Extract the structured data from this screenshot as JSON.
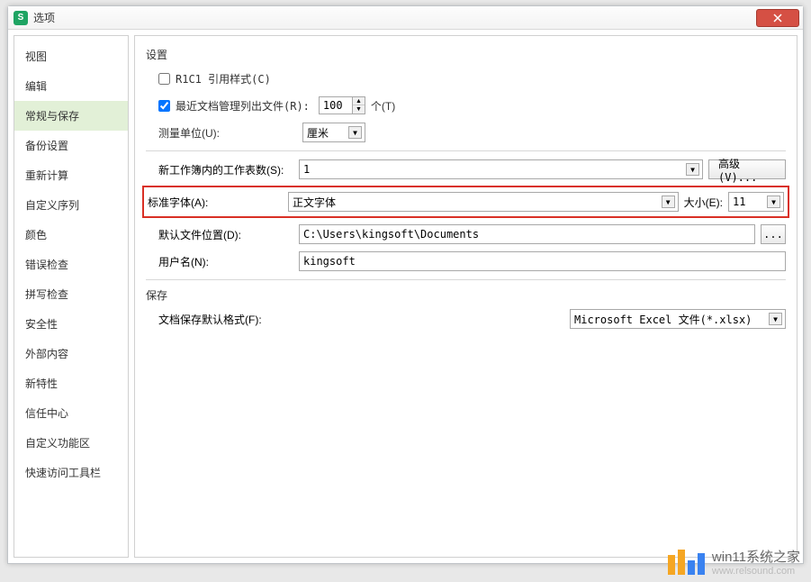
{
  "window": {
    "title": "选项"
  },
  "sidebar": {
    "items": [
      {
        "label": "视图"
      },
      {
        "label": "编辑"
      },
      {
        "label": "常规与保存"
      },
      {
        "label": "备份设置"
      },
      {
        "label": "重新计算"
      },
      {
        "label": "自定义序列"
      },
      {
        "label": "颜色"
      },
      {
        "label": "错误检查"
      },
      {
        "label": "拼写检查"
      },
      {
        "label": "安全性"
      },
      {
        "label": "外部内容"
      },
      {
        "label": "新特性"
      },
      {
        "label": "信任中心"
      },
      {
        "label": "自定义功能区"
      },
      {
        "label": "快速访问工具栏"
      }
    ],
    "active_index": 2
  },
  "settings": {
    "section1_title": "设置",
    "r1c1_label": "R1C1 引用样式(C)",
    "r1c1_checked": false,
    "recent_label": "最近文档管理列出文件(R):",
    "recent_checked": true,
    "recent_count": "100",
    "recent_unit": "个(T)",
    "unit_label": "测量单位(U):",
    "unit_value": "厘米",
    "sheets_label": "新工作簿内的工作表数(S):",
    "sheets_value": "1",
    "advanced_btn": "高级(V)...",
    "font_label": "标准字体(A):",
    "font_value": "正文字体",
    "size_label": "大小(E):",
    "size_value": "11",
    "path_label": "默认文件位置(D):",
    "path_value": "C:\\Users\\kingsoft\\Documents",
    "browse_btn": "...",
    "user_label": "用户名(N):",
    "user_value": "kingsoft",
    "section2_title": "保存",
    "save_fmt_label": "文档保存默认格式(F):",
    "save_fmt_value": "Microsoft Excel 文件(*.xlsx)"
  },
  "watermark": {
    "line1": "win11系统之家",
    "line2": "www.relsound.com"
  }
}
